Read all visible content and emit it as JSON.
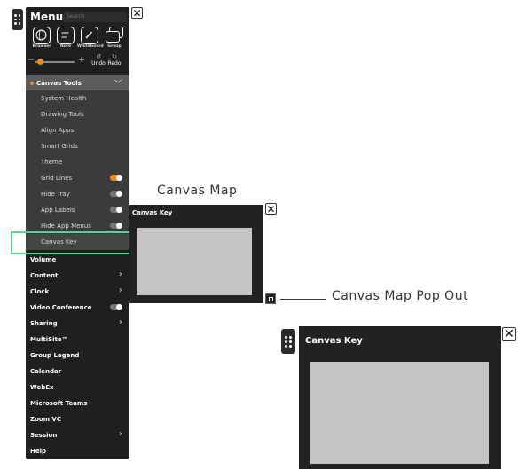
{
  "menu": {
    "title": "Menu",
    "search_placeholder": "Search",
    "tiles": [
      {
        "label": "Browser",
        "icon": "globe-icon"
      },
      {
        "label": "Note",
        "icon": "note-icon"
      },
      {
        "label": "Whiteboard",
        "icon": "whiteboard-icon"
      },
      {
        "label": "Group",
        "icon": "group-icon"
      }
    ],
    "zoom": {
      "minus": "−",
      "plus": "+",
      "level": 0.12
    },
    "undo_label": "Undo",
    "redo_label": "Redo",
    "canvas_tools": {
      "label": "Canvas Tools",
      "items": [
        {
          "label": "System Health"
        },
        {
          "label": "Drawing Tools"
        },
        {
          "label": "Align Apps"
        },
        {
          "label": "Smart Grids"
        },
        {
          "label": "Theme"
        },
        {
          "label": "Grid Lines",
          "toggle": true,
          "on": true
        },
        {
          "label": "Hide Tray",
          "toggle": true,
          "on": false
        },
        {
          "label": "App Labels",
          "toggle": true,
          "on": false
        },
        {
          "label": "Hide App Menus",
          "toggle": true,
          "on": false
        },
        {
          "label": "Canvas Key"
        }
      ]
    },
    "items": [
      {
        "label": "Volume"
      },
      {
        "label": "Content",
        "chevron": true
      },
      {
        "label": "Clock",
        "chevron": true
      },
      {
        "label": "Video Conference",
        "toggle": true,
        "on": false
      },
      {
        "label": "Sharing",
        "chevron": true
      },
      {
        "label": "MultiSite™"
      },
      {
        "label": "Group Legend"
      },
      {
        "label": "Calendar"
      },
      {
        "label": "WebEx"
      },
      {
        "label": "Microsoft Teams"
      },
      {
        "label": "Zoom VC"
      },
      {
        "label": "Session",
        "chevron": true
      },
      {
        "label": "Help"
      }
    ]
  },
  "close_glyph": "✕",
  "canvas_key_small": {
    "title": "Canvas Key"
  },
  "canvas_key_large": {
    "title": "Canvas Key"
  },
  "callouts": {
    "canvas_map": "Canvas Map",
    "canvas_map_popout": "Canvas Map Pop Out"
  },
  "colors": {
    "accent": "#f08a1c",
    "highlight": "#3fe08f",
    "menu_bg": "#1f1f1f",
    "sub_bg": "#3b3b3b"
  }
}
